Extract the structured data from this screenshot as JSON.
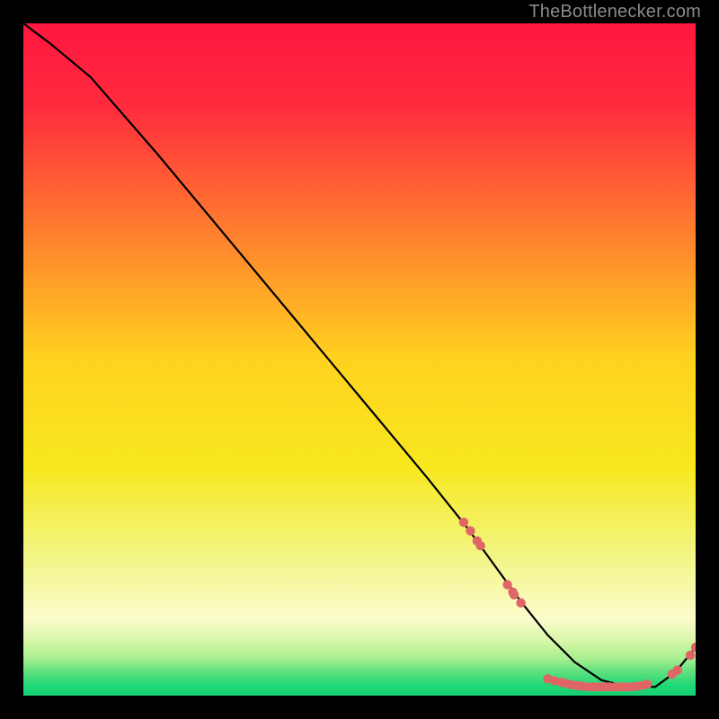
{
  "attribution": "TheBottlenecker.com",
  "chart_data": {
    "type": "line",
    "title": "",
    "xlabel": "",
    "ylabel": "",
    "xlim": [
      0,
      100
    ],
    "ylim": [
      0,
      100
    ],
    "background_gradient": [
      {
        "stop": 0.0,
        "color": "#ff173f"
      },
      {
        "stop": 0.12,
        "color": "#ff2a3d"
      },
      {
        "stop": 0.3,
        "color": "#ff7a2f"
      },
      {
        "stop": 0.5,
        "color": "#ffd21f"
      },
      {
        "stop": 0.66,
        "color": "#f7e81e"
      },
      {
        "stop": 0.8,
        "color": "#f2f68a"
      },
      {
        "stop": 0.885,
        "color": "#fdfccd"
      },
      {
        "stop": 0.918,
        "color": "#d8f7a8"
      },
      {
        "stop": 0.945,
        "color": "#a7ef90"
      },
      {
        "stop": 0.965,
        "color": "#5ee07e"
      },
      {
        "stop": 0.985,
        "color": "#1fd877"
      },
      {
        "stop": 1.0,
        "color": "#15cf73"
      }
    ],
    "series": [
      {
        "name": "curve",
        "type": "line",
        "stroke": "#000000",
        "x": [
          0,
          4,
          10,
          20,
          30,
          40,
          50,
          60,
          66,
          70,
          74,
          78,
          82,
          86,
          90,
          94,
          97,
          100
        ],
        "y": [
          100,
          97,
          92,
          80.5,
          68.5,
          56.5,
          44.5,
          32.5,
          25,
          19.5,
          14,
          9,
          5,
          2.3,
          1.3,
          1.3,
          3.5,
          7.2
        ]
      },
      {
        "name": "markers-descent",
        "type": "scatter",
        "color": "#e06666",
        "x": [
          65.5,
          66.5,
          67.5,
          68.0,
          72.0,
          72.8,
          73.0,
          74.0
        ],
        "y": [
          25.8,
          24.5,
          23.0,
          22.3,
          16.5,
          15.4,
          15.0,
          13.8
        ]
      },
      {
        "name": "markers-trough",
        "type": "scatter",
        "color": "#e06666",
        "x": [
          78.0,
          79.0,
          80.0,
          80.8,
          81.6,
          82.4,
          83.2,
          84.0,
          84.8,
          85.6,
          86.4,
          87.2,
          88.0,
          88.8,
          89.6,
          90.4,
          91.2,
          92.0,
          92.8
        ],
        "y": [
          2.5,
          2.2,
          2.0,
          1.8,
          1.6,
          1.5,
          1.4,
          1.3,
          1.3,
          1.3,
          1.3,
          1.3,
          1.3,
          1.3,
          1.3,
          1.3,
          1.4,
          1.5,
          1.7
        ]
      },
      {
        "name": "markers-rise",
        "type": "scatter",
        "color": "#e06666",
        "x": [
          96.5,
          97.3,
          99.2,
          100.0
        ],
        "y": [
          3.2,
          3.8,
          6.0,
          7.2
        ]
      }
    ]
  }
}
